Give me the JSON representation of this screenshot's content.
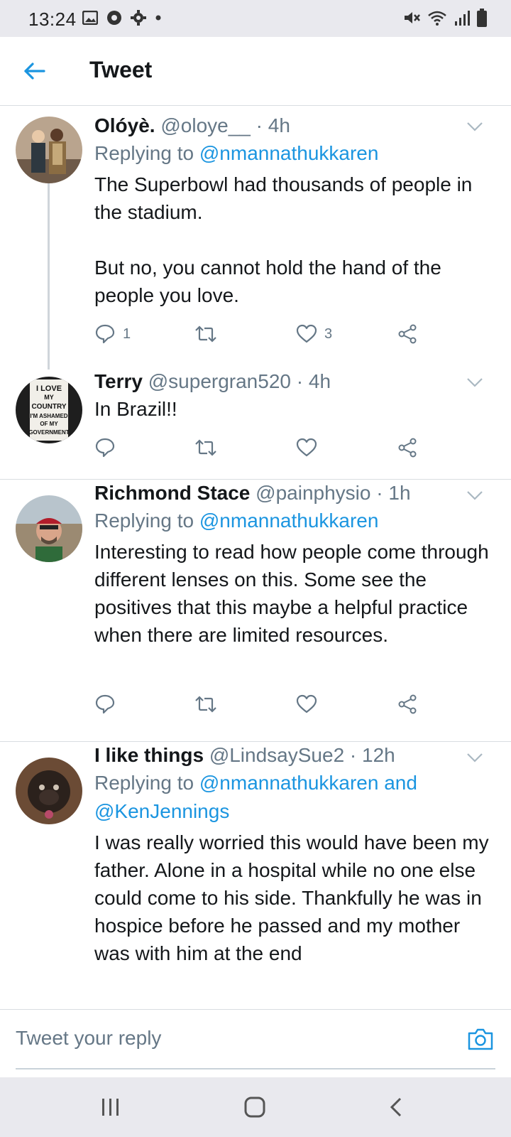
{
  "status_bar": {
    "time": "13:24",
    "left_icons": [
      "image-icon",
      "chrome-icon",
      "gear-icon",
      "dot-icon"
    ],
    "right_icons": [
      "mute-icon",
      "wifi-icon",
      "signal-icon",
      "battery-icon"
    ]
  },
  "header": {
    "title": "Tweet",
    "back_icon": "back-arrow-icon"
  },
  "tweets": [
    {
      "name": "Olóyè.",
      "handle": "@oloye__",
      "dot": "·",
      "time": "4h",
      "replying_prefix": "Replying to ",
      "replying_to": "@nmannathukkaren",
      "text": "The Superbowl had thousands of people in the stadium.\n\nBut no, you cannot hold the hand of the people you love.",
      "reply_count": "1",
      "like_count": "3"
    },
    {
      "name": "Terry",
      "handle": "@supergran520",
      "dot": "·",
      "time": "4h",
      "text": "In Brazil!!",
      "avatar_sign_lines": [
        "I LOVE",
        "MY",
        "COUNTRY",
        "I'M ASHAMED",
        "OF MY",
        "GOVERNMENT"
      ]
    },
    {
      "name": "Richmond Stace",
      "handle": "@painphysio",
      "dot": "·",
      "time": "1h",
      "replying_prefix": "Replying to ",
      "replying_to": "@nmannathukkaren",
      "text": "Interesting to read how people come through different lenses on this. Some see the positives that this maybe a helpful practice when there are limited resources."
    },
    {
      "name": "I like things",
      "handle": "@LindsaySue2",
      "dot": "·",
      "time": "12h",
      "replying_prefix": "Replying to ",
      "replying_to": "@nmannathukkaren and",
      "replying_to_2": "@KenJennings",
      "text": "I was really worried this would have been my father. Alone in a hospital while no one else could come to his side. Thankfully he was in hospice before he passed and my mother was with him at the end"
    }
  ],
  "reply_bar": {
    "placeholder": "Tweet your reply",
    "camera_icon": "camera-icon"
  },
  "nav_bar": {
    "icons": [
      "recents-icon",
      "home-icon",
      "back-icon"
    ]
  },
  "colors": {
    "link": "#1b95e0",
    "secondary_text": "#657786",
    "primary_text": "#14171a",
    "divider": "#d9dde1",
    "system_bar": "#e9e9ee"
  }
}
